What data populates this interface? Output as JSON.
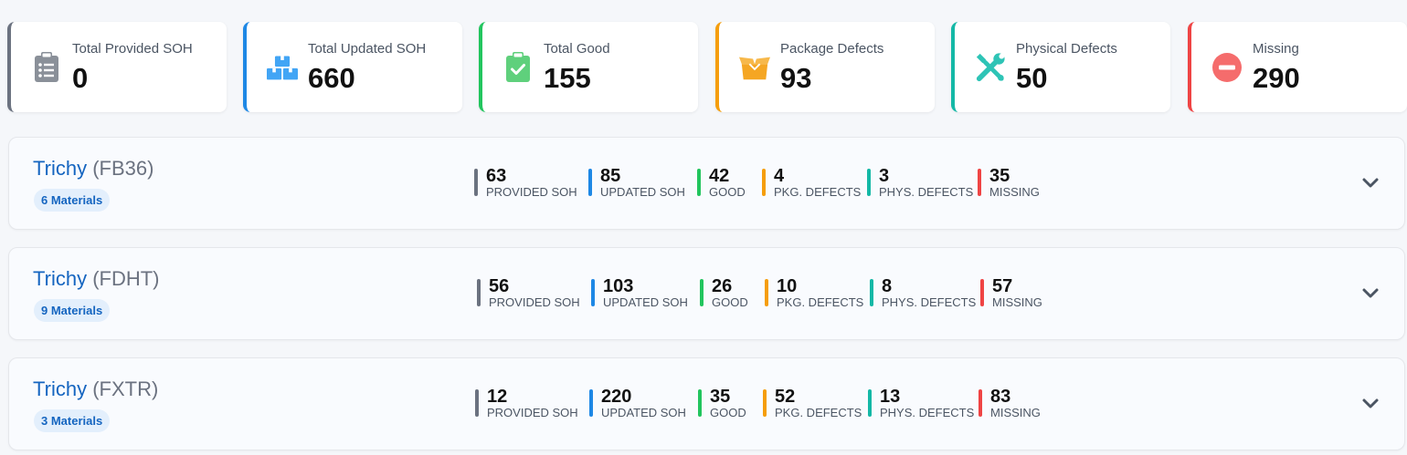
{
  "summary": {
    "cards": [
      {
        "label": "Total Provided SOH",
        "value": "0",
        "color": "#6b7280",
        "icon": "clipboard-list-icon"
      },
      {
        "label": "Total Updated SOH",
        "value": "660",
        "color": "#1e88e5",
        "icon": "boxes-icon"
      },
      {
        "label": "Total Good",
        "value": "155",
        "color": "#22c55e",
        "icon": "clipboard-check-icon"
      },
      {
        "label": "Package Defects",
        "value": "93",
        "color": "#f59e0b",
        "icon": "open-box-icon"
      },
      {
        "label": "Physical Defects",
        "value": "50",
        "color": "#14b8a6",
        "icon": "tools-icon"
      },
      {
        "label": "Missing",
        "value": "290",
        "color": "#ef4444",
        "icon": "minus-circle-icon"
      }
    ]
  },
  "stat_colors": [
    "#6b7280",
    "#1e88e5",
    "#22c55e",
    "#f59e0b",
    "#14b8a6",
    "#ef4444"
  ],
  "stat_labels": [
    "PROVIDED SOH",
    "UPDATED SOH",
    "GOOD",
    "PKG. DEFECTS",
    "PHYS. DEFECTS",
    "MISSING"
  ],
  "rows": [
    {
      "name": "Trichy",
      "code": "(FB36)",
      "badge": "6 Materials",
      "stats": [
        "63",
        "85",
        "42",
        "4",
        "3",
        "35"
      ]
    },
    {
      "name": "Trichy",
      "code": "(FDHT)",
      "badge": "9 Materials",
      "stats": [
        "56",
        "103",
        "26",
        "10",
        "8",
        "57"
      ]
    },
    {
      "name": "Trichy",
      "code": "(FXTR)",
      "badge": "3 Materials",
      "stats": [
        "12",
        "220",
        "35",
        "52",
        "13",
        "83"
      ]
    }
  ]
}
